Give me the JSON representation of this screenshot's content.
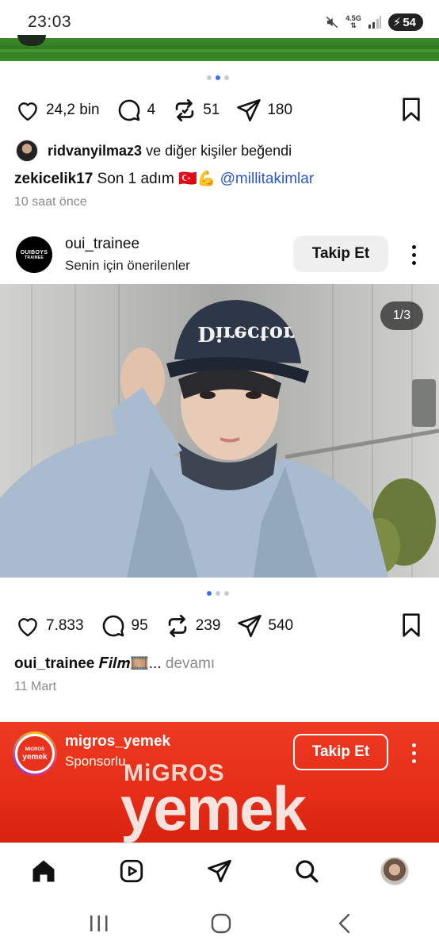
{
  "status_bar": {
    "time": "23:03",
    "network": "4.5G",
    "battery": "54"
  },
  "post1": {
    "likes": "24,2 bin",
    "comments": "4",
    "reposts": "51",
    "shares": "180",
    "liked_by_user": "ridvanyilmaz3",
    "liked_by_rest": "ve diğer kişiler beğendi",
    "caption_user": "zekicelik17",
    "caption_text": "Son 1 adım 🇹🇷💪",
    "caption_mention": "@millitakimlar",
    "time_ago": "10 saat önce"
  },
  "post2": {
    "username": "oui_trainee",
    "subtitle": "Senin için önerilenler",
    "avatar_text": "OUIBOYS",
    "avatar_subtext": "TRAINEE",
    "follow_label": "Takip Et",
    "photo_counter": "1/3",
    "likes": "7.833",
    "comments": "95",
    "reposts": "239",
    "shares": "540",
    "caption_user": "oui_trainee",
    "caption_text": "𝑭𝒊𝒍𝒎🎞️...",
    "caption_more": "devamı",
    "date": "11 Mart"
  },
  "sponsored": {
    "username": "migros_yemek",
    "subtitle": "Sponsorlu",
    "follow_label": "Takip Et",
    "avatar_line1": "MIGROS",
    "avatar_line2": "yemek",
    "brand_small": "MiGROS",
    "brand_big": "yemek"
  },
  "colors": {
    "accent": "#3b6ff0",
    "mention": "#2c57c9",
    "sponsor_bg": "#e52d18"
  },
  "icons": {
    "like": "heart-icon",
    "comment": "comment-icon",
    "repost": "repost-icon",
    "share": "send-icon",
    "save": "bookmark-icon",
    "nav": [
      "home-icon",
      "reels-icon",
      "send-icon",
      "search-icon",
      "profile-icon"
    ]
  }
}
